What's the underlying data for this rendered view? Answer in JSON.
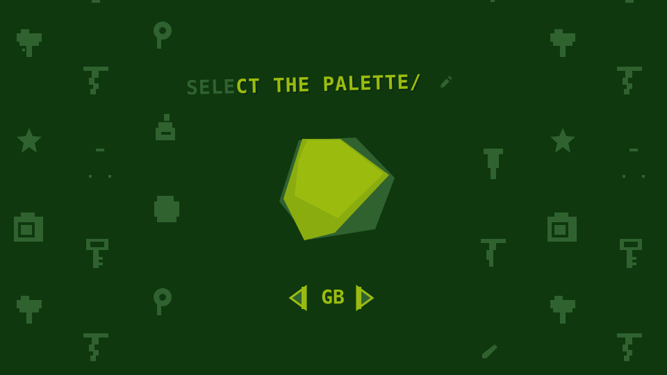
{
  "title": {
    "part_dim": "SELE",
    "part_bright": "CT THE PALETTE",
    "suffix": "/"
  },
  "palette": {
    "current_name": "GB",
    "prev_icon": "arrow-left-icon",
    "next_icon": "arrow-right-icon"
  },
  "colors": {
    "background": "#0f380f",
    "dark": "#306230",
    "light": "#8bac0f",
    "lightest": "#9bbc0f"
  },
  "background_icons": [
    "tree-icon",
    "balloon-icon",
    "sword-icon",
    "star-icon",
    "potion-icon",
    "camera-icon",
    "key-icon",
    "mushroom-icon",
    "pen-icon"
  ]
}
